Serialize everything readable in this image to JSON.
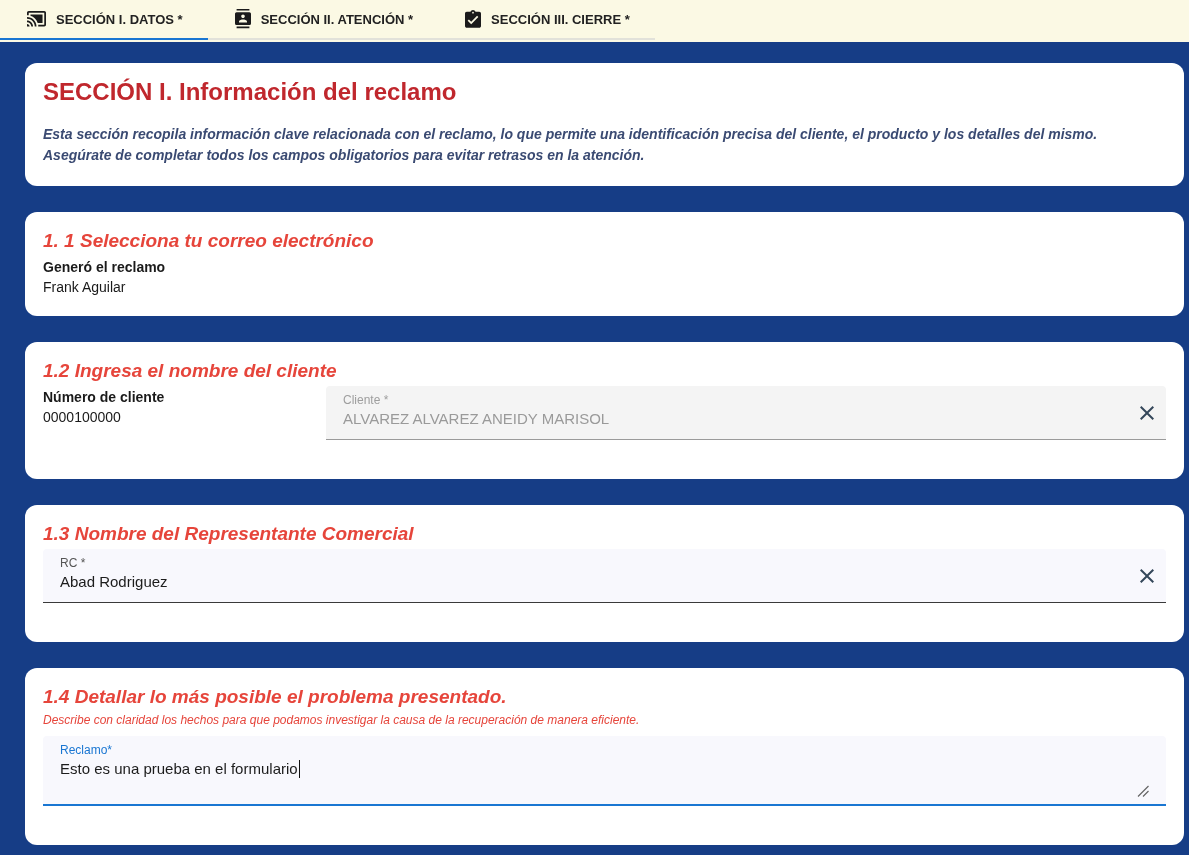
{
  "tabs": [
    {
      "label": "SECCIÓN I. DATOS *",
      "selected": true
    },
    {
      "label": "SECCIÓN II. ATENCIÓN *",
      "selected": false
    },
    {
      "label": "SECCIÓN III. CIERRE *",
      "selected": false
    }
  ],
  "header": {
    "title": "SECCIÓN I. Información del reclamo",
    "description": [
      "Esta sección recopila información clave relacionada con el reclamo, lo que permite una identificación precisa del cliente, el producto y los detalles del mismo.",
      "Asegúrate de completar todos los campos obligatorios para evitar retrasos en la atención."
    ]
  },
  "sections": [
    {
      "kind": "readonly",
      "title": "1. 1 Selecciona tu correo electrónico",
      "label": "Generó el reclamo",
      "value": "Frank Aguilar"
    },
    {
      "kind": "client",
      "title": "1.2 Ingresa el nombre del cliente",
      "label": "Número de cliente",
      "value": "0000100000",
      "field": {
        "label": "Cliente *",
        "value": "ALVAREZ ALVAREZ ANEIDY MARISOL",
        "disabled": true,
        "focused": false,
        "clearable": true
      }
    },
    {
      "kind": "select",
      "title": "1.3 Nombre del Representante Comercial",
      "field": {
        "label": "RC *",
        "value": "Abad Rodriguez",
        "disabled": false,
        "focused": false,
        "clearable": true
      }
    },
    {
      "kind": "textarea",
      "title": "1.4 Detallar lo más posible el problema presentado.",
      "hint": "Describe con claridad los hechos para que podamos investigar la causa de la recuperación de manera eficiente.",
      "field": {
        "label": "Reclamo*",
        "value": "Esto es una prueba en el formulario",
        "disabled": false,
        "focused": true
      }
    }
  ]
}
